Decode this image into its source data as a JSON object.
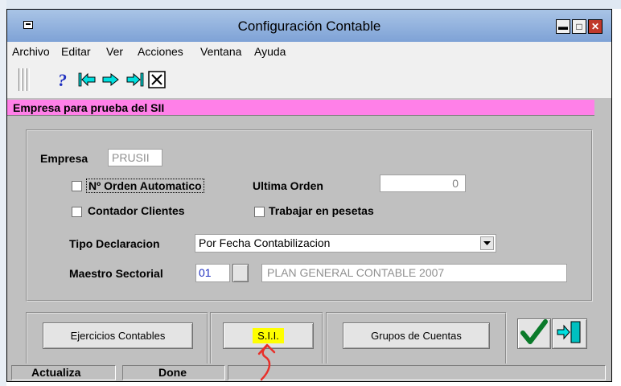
{
  "window": {
    "title": "Configuración Contable",
    "min_glyph": "▬",
    "max_glyph": "□",
    "close_glyph": "✕"
  },
  "menu": [
    "Archivo",
    "Editar",
    "Ver",
    "Acciones",
    "Ventana",
    "Ayuda"
  ],
  "toolbar": {
    "icons": [
      "help-icon",
      "first-record-icon",
      "next-record-icon",
      "last-record-icon",
      "close-icon"
    ]
  },
  "banner": {
    "text": "Empresa para prueba del SII",
    "color": "#ff80e8"
  },
  "form": {
    "empresa_label": "Empresa",
    "empresa_value": "PRUSII",
    "orden_auto_label": "Nº Orden Automatico",
    "ultima_orden_label": "Ultima Orden",
    "ultima_orden_value": "0",
    "contador_label": "Contador Clientes",
    "pesetas_label": "Trabajar en pesetas",
    "tipo_decl_label": "Tipo Declaracion",
    "tipo_decl_value": "Por Fecha Contabilizacion",
    "maestro_label": "Maestro Sectorial",
    "maestro_code": "01",
    "maestro_desc": "PLAN GENERAL CONTABLE 2007"
  },
  "buttons": {
    "ejercicios": "Ejercicios Contables",
    "sii": "S.I.I.",
    "grupos": "Grupos de Cuentas",
    "sii_highlight": "#ffff00",
    "annotation_color": "#e8302a"
  },
  "status": {
    "left": "Actualiza",
    "middle": "Done"
  }
}
